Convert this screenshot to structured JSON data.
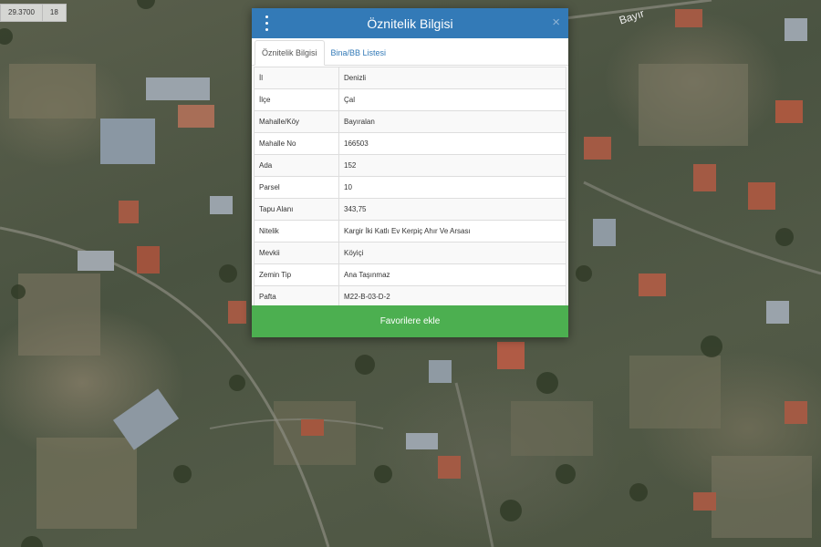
{
  "readout": {
    "coordinate": "29.3700",
    "zoom": "18"
  },
  "map": {
    "road_label": "Bayır"
  },
  "dialog": {
    "title": "Öznitelik Bilgisi",
    "close_glyph": "×",
    "tabs": [
      {
        "label": "Öznitelik Bilgisi",
        "active": true
      },
      {
        "label": "Bina/BB Listesi",
        "active": false
      }
    ],
    "rows": [
      {
        "key": "İl",
        "value": "Denizli"
      },
      {
        "key": "İlçe",
        "value": "Çal"
      },
      {
        "key": "Mahalle/Köy",
        "value": "Bayıralan"
      },
      {
        "key": "Mahalle No",
        "value": "166503"
      },
      {
        "key": "Ada",
        "value": "152"
      },
      {
        "key": "Parsel",
        "value": "10"
      },
      {
        "key": "Tapu Alanı",
        "value": "343,75"
      },
      {
        "key": "Nitelik",
        "value": "Kargir İki Katlı Ev Kerpiç Ahır Ve Arsası"
      },
      {
        "key": "Mevkii",
        "value": "Köyiçi"
      },
      {
        "key": "Zemin Tip",
        "value": "Ana Taşınmaz"
      },
      {
        "key": "Pafta",
        "value": "M22-B-03-D-2"
      }
    ],
    "favorite_button": "Favorilere ekle"
  },
  "colors": {
    "header": "#337ab7",
    "favorite_button": "#4caf50"
  }
}
